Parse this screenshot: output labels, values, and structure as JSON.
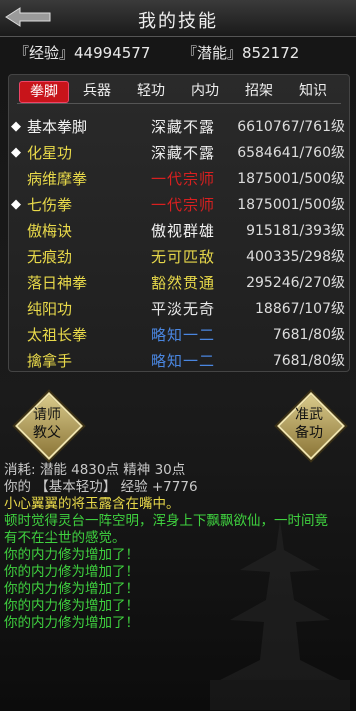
{
  "header": {
    "title": "我的技能"
  },
  "stats": {
    "exp_label": "『经验』",
    "exp_value": "44994577",
    "pot_label": "『潜能』",
    "pot_value": "852172"
  },
  "tabs": [
    {
      "label": "拳脚",
      "active": true
    },
    {
      "label": "兵器",
      "active": false
    },
    {
      "label": "轻功",
      "active": false
    },
    {
      "label": "内功",
      "active": false
    },
    {
      "label": "招架",
      "active": false
    },
    {
      "label": "知识",
      "active": false
    }
  ],
  "skills": [
    {
      "marker": "◆",
      "name": "基本拳脚",
      "level_title": "深藏不露",
      "value": "6610767/761级",
      "name_color": "#f2f2f2",
      "title_color": "#eeeeee"
    },
    {
      "marker": "◆",
      "name": "化星功",
      "level_title": "深藏不露",
      "value": "6584641/760级",
      "name_color": "#e8d94a",
      "title_color": "#eeeeee"
    },
    {
      "marker": "",
      "name": "病维摩拳",
      "level_title": "一代宗师",
      "value": "1875001/500级",
      "name_color": "#e8d94a",
      "title_color": "#d82020"
    },
    {
      "marker": "◆",
      "name": "七伤拳",
      "level_title": "一代宗师",
      "value": "1875001/500级",
      "name_color": "#e8d94a",
      "title_color": "#d82020"
    },
    {
      "marker": "",
      "name": "傲梅诀",
      "level_title": "傲视群雄",
      "value": "915181/393级",
      "name_color": "#e8d94a",
      "title_color": "#f2f2f2"
    },
    {
      "marker": "",
      "name": "无痕劲",
      "level_title": "无可匹敌",
      "value": "400335/298级",
      "name_color": "#e8d94a",
      "title_color": "#e8d94a"
    },
    {
      "marker": "",
      "name": "落日神拳",
      "level_title": "豁然贯通",
      "value": "295246/270级",
      "name_color": "#e8d94a",
      "title_color": "#e8d94a"
    },
    {
      "marker": "",
      "name": "纯阳功",
      "level_title": "平淡无奇",
      "value": "18867/107级",
      "name_color": "#e8d94a",
      "title_color": "#e8e8e8"
    },
    {
      "marker": "",
      "name": "太祖长拳",
      "level_title": "略知一二",
      "value": "7681/80级",
      "name_color": "#e8d94a",
      "title_color": "#4a86e0"
    },
    {
      "marker": "",
      "name": "擒拿手",
      "level_title": "略知一二",
      "value": "7681/80级",
      "name_color": "#e8d94a",
      "title_color": "#4a86e0"
    }
  ],
  "buttons": {
    "left_line1": "请师",
    "left_line2": "教父",
    "right_line1": "准武",
    "right_line2": "备功"
  },
  "log": [
    {
      "text": "消耗: 潜能 4830点  精神 30点",
      "color": "#c8c8c8"
    },
    {
      "text": "你的 【基本轻功】 经验 +7776",
      "color": "#c8c8c8"
    },
    {
      "text": "小心翼翼的将玉露含在嘴中。",
      "color": "#e8d94a"
    },
    {
      "text": "顿时觉得灵台一阵空明，浑身上下飘飘欲仙，一时间竟",
      "color": "#3fd13f"
    },
    {
      "text": "有不在尘世的感觉。",
      "color": "#3fd13f"
    },
    {
      "text": "你的内力修为增加了！",
      "color": "#3fd13f"
    },
    {
      "text": "你的内力修为增加了！",
      "color": "#3fd13f"
    },
    {
      "text": "你的内力修为增加了！",
      "color": "#3fd13f"
    },
    {
      "text": "你的内力修为增加了！",
      "color": "#3fd13f"
    },
    {
      "text": "你的内力修为增加了！",
      "color": "#3fd13f"
    }
  ]
}
